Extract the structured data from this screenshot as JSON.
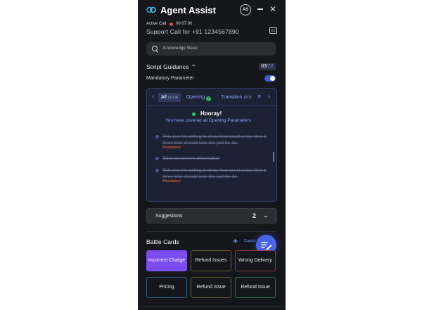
{
  "header": {
    "title": "Agent Assist",
    "avatar_initials": "AS",
    "close_glyph": "✕"
  },
  "call": {
    "status_label": "Active Call",
    "timer": "00:07:00",
    "support_line": "Support Call for +91 1234567890",
    "cc_label": "CC"
  },
  "search": {
    "placeholder": "Knowledge Base"
  },
  "script_guidance": {
    "title": "Script Guidance",
    "chevron": "⌄",
    "counter_current": "03",
    "counter_total": "/22",
    "mandatory_label": "Mandatory Parameter",
    "mandatory_enabled": true,
    "tabs": [
      {
        "label": "All",
        "count": "(3/14)",
        "active": true
      },
      {
        "label": "Opening",
        "count": "",
        "complete": true
      },
      {
        "label": "Transition",
        "count": "(0/7)"
      },
      {
        "label": "F",
        "count": ""
      }
    ],
    "tab_prev": "‹",
    "tab_next": "›",
    "hooray_title": "Hooray!",
    "hooray_subtitle": "You have covered all Opening Parameters",
    "items": [
      {
        "text": "This text I'm writing to show how could a two liner a three liner should look like just for da.",
        "tag": "Mandatory"
      },
      {
        "text": "Take customer's information",
        "tag": ""
      },
      {
        "text": "This text I'm writing to show how could a two liner a three liner should look like just for da.",
        "tag": "Mandatory"
      }
    ]
  },
  "suggestions": {
    "label": "Suggestions",
    "count": "2",
    "chevron": "⌄"
  },
  "battle_cards": {
    "title": "Battle Cards",
    "add_glyph": "+",
    "capture_label": "Captur",
    "cards": [
      {
        "label": "Incorrect Charge",
        "border": "#7b4cf0",
        "fill": "#7b4cf0"
      },
      {
        "label": "Refund Issues",
        "border": "#6b5a2a",
        "fill": ""
      },
      {
        "label": "Wrong Delivery",
        "border": "#8a3640",
        "fill": ""
      },
      {
        "label": "Pricing",
        "border": "#2b5f86",
        "fill": ""
      },
      {
        "label": "Refund Issue",
        "border": "#5c5a30",
        "fill": ""
      },
      {
        "label": "Refund Issue",
        "border": "#2d6a45",
        "fill": ""
      }
    ]
  },
  "colors": {
    "panel_bg": "#16171c",
    "accent": "#4a63e8",
    "link": "#8aa2ff",
    "success": "#35c06e",
    "mandatory_tag": "#e86d3a"
  }
}
